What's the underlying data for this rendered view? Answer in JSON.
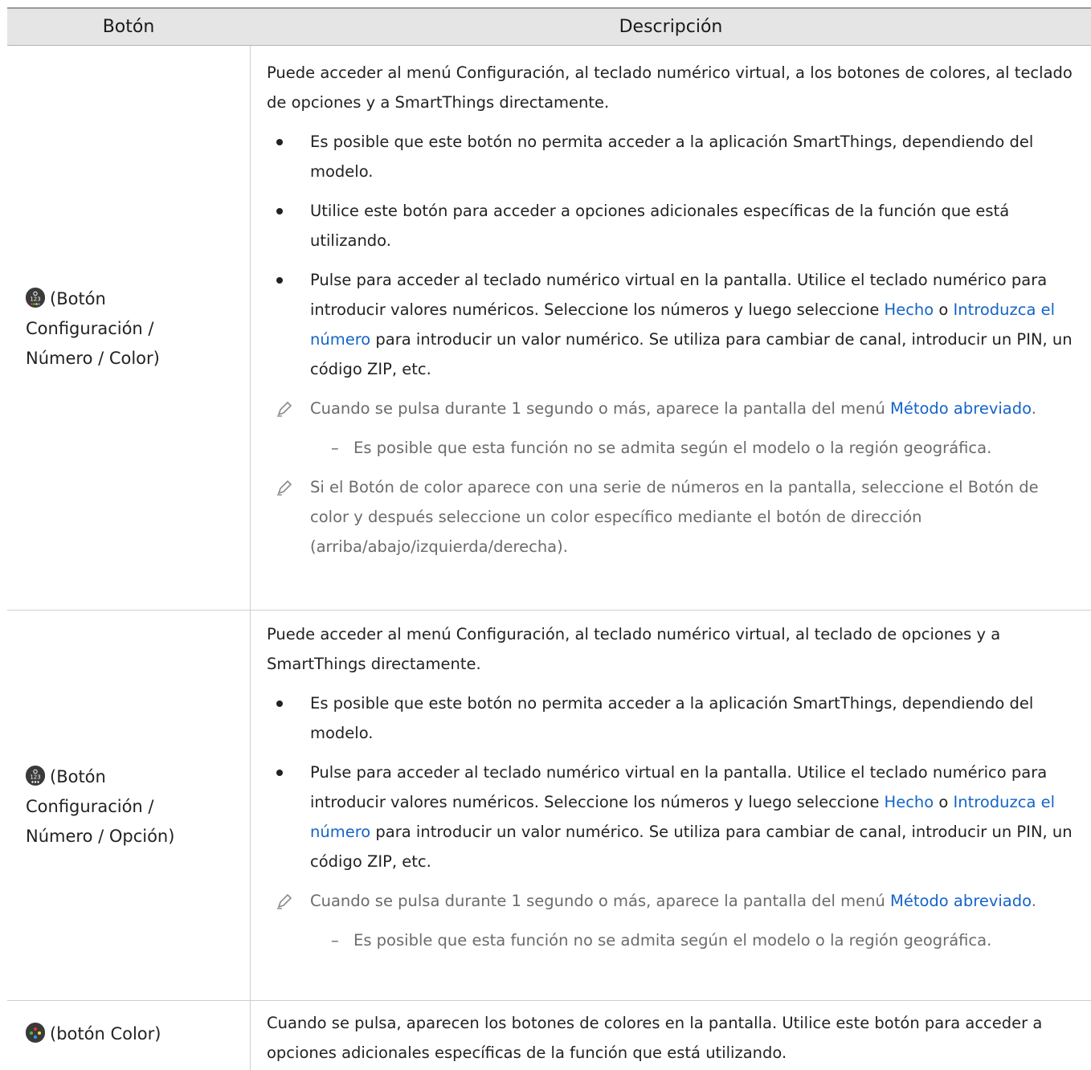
{
  "header": {
    "col_button": "Botón",
    "col_description": "Descripción"
  },
  "rows": [
    {
      "button_label_line1": "(Botón",
      "button_label_line2": "Configuración /",
      "button_label_line3": "Número / Color)",
      "icon": "settings-123-color-icon",
      "intro": "Puede acceder al menú Configuración, al teclado numérico virtual, a los botones de colores, al teclado de opciones y a SmartThings directamente.",
      "bullet1": "Es posible que este botón no permita acceder a la aplicación SmartThings, dependiendo del modelo.",
      "bullet2": "Utilice este botón para acceder a opciones adicionales específicas de la función que está utilizando.",
      "bullet3_a": "Pulse para acceder al teclado numérico virtual en la pantalla. Utilice el teclado numérico para introducir valores numéricos. Seleccione los números y luego seleccione ",
      "bullet3_link1": "Hecho",
      "bullet3_b": " o ",
      "bullet3_link2": "Introduzca el número",
      "bullet3_c": " para introducir un valor numérico. Se utiliza para cambiar de canal, introducir un PIN, un código ZIP, etc.",
      "note1_a": "Cuando se pulsa durante 1 segundo o más, aparece la pantalla del menú ",
      "note1_link": "Método abreviado",
      "note1_b": ".",
      "sub1": "Es posible que esta función no se admita según el modelo o la región geográfica.",
      "note2": "Si el Botón de color aparece con una serie de números en la pantalla, seleccione el Botón de color y después seleccione un color específico mediante el botón de dirección (arriba/abajo/izquierda/derecha)."
    },
    {
      "button_label_line1": "(Botón",
      "button_label_line2": "Configuración /",
      "button_label_line3": "Número / Opción)",
      "icon": "settings-123-option-icon",
      "intro": "Puede acceder al menú Configuración, al teclado numérico virtual, al teclado de opciones y a SmartThings directamente.",
      "bullet1": "Es posible que este botón no permita acceder a la aplicación SmartThings, dependiendo del modelo.",
      "bullet3_a": "Pulse para acceder al teclado numérico virtual en la pantalla. Utilice el teclado numérico para introducir valores numéricos. Seleccione los números y luego seleccione ",
      "bullet3_link1": "Hecho",
      "bullet3_b": " o ",
      "bullet3_link2": "Introduzca el número",
      "bullet3_c": " para introducir un valor numérico. Se utiliza para cambiar de canal, introducir un PIN, un código ZIP, etc.",
      "note1_a": "Cuando se pulsa durante 1 segundo o más, aparece la pantalla del menú ",
      "note1_link": "Método abreviado",
      "note1_b": ".",
      "sub1": "Es posible que esta función no se admita según el modelo o la región geográfica."
    },
    {
      "button_label": "(botón Color)",
      "icon": "color-button-icon",
      "intro": "Cuando se pulsa, aparecen los botones de colores en la pantalla. Utilice este botón para acceder a opciones adicionales específicas de la función que está utilizando."
    }
  ]
}
